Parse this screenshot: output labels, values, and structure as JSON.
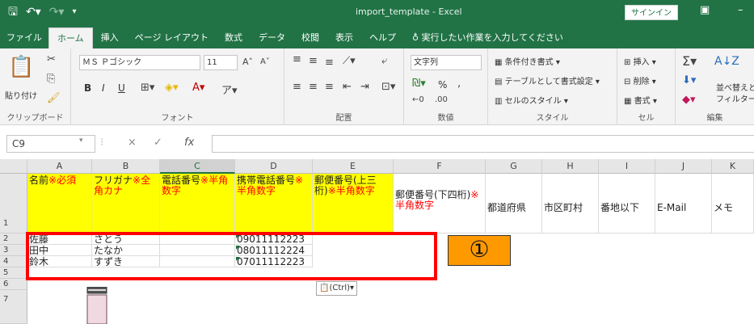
{
  "window": {
    "title": "import_template - Excel",
    "signin_label": "サインイン",
    "restore_icon": "ribbon-display-icon",
    "minimize_label": "–"
  },
  "qat": {
    "save_icon": "save-icon",
    "undo_icon": "undo-icon",
    "redo_icon": "redo-icon",
    "customize_icon": "customize-icon"
  },
  "tabs": [
    {
      "label": "ファイル"
    },
    {
      "label": "ホーム"
    },
    {
      "label": "挿入"
    },
    {
      "label": "ページ レイアウト"
    },
    {
      "label": "数式"
    },
    {
      "label": "データ"
    },
    {
      "label": "校閲"
    },
    {
      "label": "表示"
    },
    {
      "label": "ヘルプ"
    },
    {
      "label": "実行したい作業を入力してください"
    }
  ],
  "ribbon": {
    "clipboard": {
      "label": "クリップボード",
      "paste": "貼り付け"
    },
    "font": {
      "label": "フォント",
      "name": "ＭＳ Ｐゴシック",
      "size": "11",
      "bold": "B",
      "italic": "I",
      "underline": "U"
    },
    "alignment": {
      "label": "配置"
    },
    "number": {
      "label": "数値",
      "format": "文字列",
      "percent": "%"
    },
    "styles": {
      "label": "スタイル",
      "conditional": "条件付き書式",
      "table": "テーブルとして書式設定",
      "cell": "セルのスタイル"
    },
    "cells": {
      "label": "セル",
      "insert": "挿入",
      "delete": "削除",
      "format": "書式"
    },
    "editing": {
      "label": "編集",
      "sort": "並べ替えと",
      "filter": "フィルター"
    }
  },
  "formula_bar": {
    "name_box": "C9",
    "fx": "fx",
    "cancel": "×",
    "enter": "✓"
  },
  "columns": [
    "A",
    "B",
    "C",
    "D",
    "E",
    "F",
    "G",
    "H",
    "I",
    "J",
    "K"
  ],
  "rows": [
    "1",
    "2",
    "3",
    "4",
    "5",
    "6",
    "7"
  ],
  "headers": {
    "A": {
      "black": "名前",
      "red": "※必須"
    },
    "B": {
      "black": "フリガナ",
      "red": "※全角カナ"
    },
    "C": {
      "black": "電話番号",
      "red": "※半角数字"
    },
    "D": {
      "black": "携帯電話番号",
      "red": "※半角数字"
    },
    "E": {
      "black": "郵便番号(上三桁)",
      "red": "※半角数字"
    },
    "F": {
      "black": "郵便番号(下四桁)",
      "red": "※半角数字"
    },
    "G": "都道府県",
    "H": "市区町村",
    "I": "番地以下",
    "J": "E-Mail",
    "K": "メモ"
  },
  "data_rows": [
    {
      "name": "佐藤",
      "kana": "さとう",
      "mobile": "09011112223"
    },
    {
      "name": "田中",
      "kana": "たなか",
      "mobile": "08011112224"
    },
    {
      "name": "鈴木",
      "kana": "すずき",
      "mobile": "07011112223"
    }
  ],
  "annotation": {
    "badge": "①",
    "color": "#ff0000",
    "badge_color": "#ff9900"
  },
  "paste_options": {
    "label": "(Ctrl)▾"
  },
  "accent": "#217346"
}
